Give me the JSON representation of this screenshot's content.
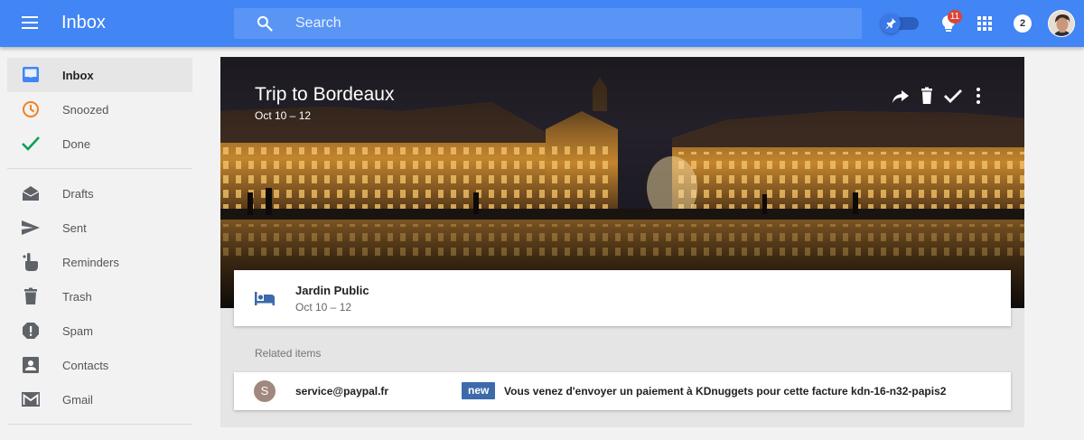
{
  "topbar": {
    "app_title": "Inbox",
    "search_placeholder": "Search",
    "notification_count": "11",
    "account_count": "2",
    "colors": {
      "bar": "#4285f4",
      "badge": "#db4437"
    }
  },
  "sidebar": {
    "primary": [
      {
        "label": "Inbox",
        "icon": "inbox-icon",
        "active": true
      },
      {
        "label": "Snoozed",
        "icon": "clock-icon"
      },
      {
        "label": "Done",
        "icon": "check-icon"
      }
    ],
    "secondary": [
      {
        "label": "Drafts",
        "icon": "drafts-icon"
      },
      {
        "label": "Sent",
        "icon": "send-icon"
      },
      {
        "label": "Reminders",
        "icon": "reminder-hand-icon"
      },
      {
        "label": "Trash",
        "icon": "trash-icon"
      },
      {
        "label": "Spam",
        "icon": "spam-icon"
      },
      {
        "label": "Contacts",
        "icon": "contacts-icon"
      },
      {
        "label": "Gmail",
        "icon": "gmail-icon"
      }
    ]
  },
  "trip": {
    "title": "Trip to Bordeaux",
    "dates": "Oct 10 – 12",
    "actions": [
      "forward-icon",
      "trash-icon",
      "check-icon",
      "more-vert-icon"
    ],
    "lodging": {
      "name": "Jardin Public",
      "dates": "Oct 10 – 12",
      "icon": "bed-icon"
    }
  },
  "related": {
    "heading": "Related items",
    "items": [
      {
        "avatar_letter": "S",
        "sender": "service@paypal.fr",
        "badge": "new",
        "subject": "Vous venez d'envoyer un paiement à KDnuggets pour cette facture kdn-16-n32-papis2"
      }
    ]
  }
}
